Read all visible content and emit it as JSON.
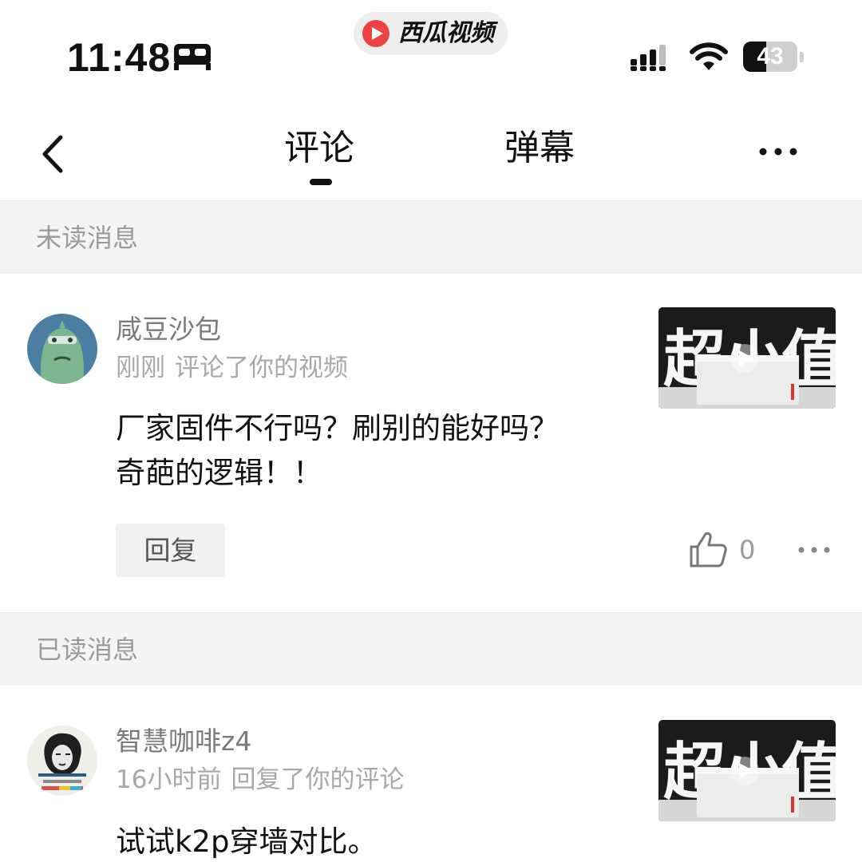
{
  "status_bar": {
    "time": "11:48",
    "app_name": "西瓜视频",
    "battery_level": "43",
    "battery_fraction": 0.43
  },
  "header": {
    "tabs": [
      {
        "label": "评论",
        "active": true
      },
      {
        "label": "弹幕",
        "active": false
      }
    ]
  },
  "sections": [
    {
      "title": "未读消息",
      "items": [
        {
          "username": "咸豆沙包",
          "time": "刚刚",
          "action": "评论了你的视频",
          "comment_lines": [
            "厂家固件不行吗？刷别的能好吗？",
            "奇葩的逻辑！！"
          ],
          "reply_label": "回复",
          "like_count": "0",
          "thumbnail_text": "超小值"
        }
      ]
    },
    {
      "title": "已读消息",
      "items": [
        {
          "username": "智慧咖啡z4",
          "time": "16小时前",
          "action": "回复了你的评论",
          "comment_lines": [
            "试试k2p穿墙对比。"
          ],
          "thumbnail_text": "超小值"
        }
      ]
    }
  ],
  "colors": {
    "section_bg": "#f4f4f4",
    "muted_text": "#a8a8a8",
    "brand_red": "#f04142"
  },
  "icons": {
    "back": "chevron-left-icon",
    "more": "ellipsis-icon",
    "like": "thumbs-up-icon",
    "bed": "bed-icon",
    "signal": "signal-icon",
    "wifi": "wifi-icon",
    "play": "play-icon"
  }
}
